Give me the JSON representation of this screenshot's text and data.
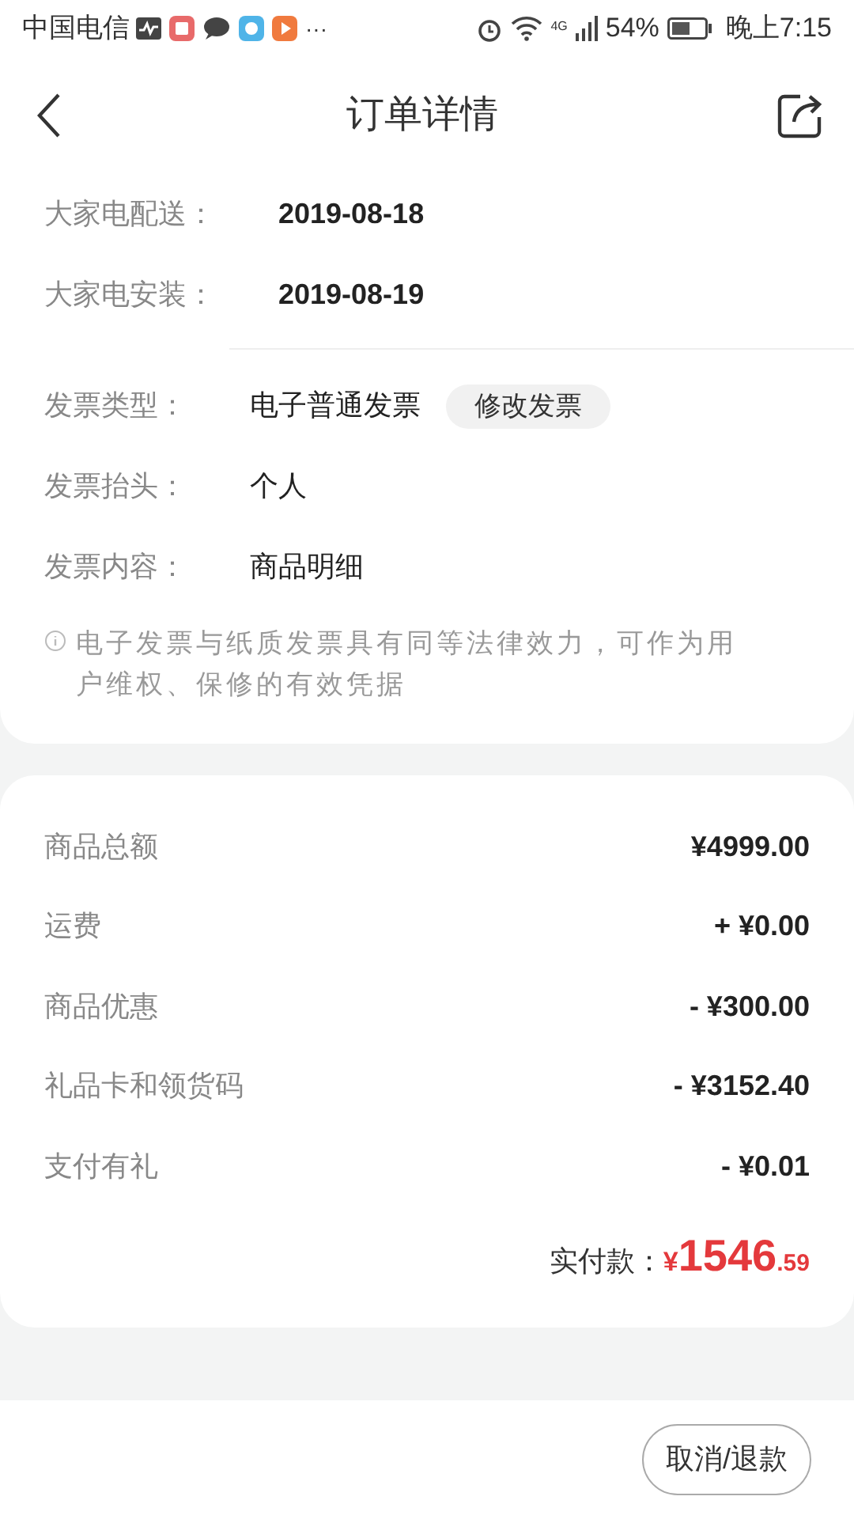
{
  "status_bar": {
    "carrier": "中国电信",
    "more": "···",
    "battery_text": "54%",
    "time": "晚上7:15",
    "network": "4G"
  },
  "header": {
    "title": "订单详情"
  },
  "delivery": [
    {
      "label": "大家电配送：",
      "value": "2019-08-18"
    },
    {
      "label": "大家电安装：",
      "value": "2019-08-19"
    }
  ],
  "invoice": {
    "rows": [
      {
        "label": "发票类型：",
        "value": "电子普通发票",
        "action": "修改发票"
      },
      {
        "label": "发票抬头：",
        "value": "个人"
      },
      {
        "label": "发票内容：",
        "value": "商品明细"
      }
    ],
    "note": "电子发票与纸质发票具有同等法律效力，可作为用户维权、保修的有效凭据"
  },
  "costs": [
    {
      "label": "商品总额",
      "value": "¥4999.00"
    },
    {
      "label": "运费",
      "value": "+ ¥0.00"
    },
    {
      "label": "商品优惠",
      "value": "- ¥300.00"
    },
    {
      "label": "礼品卡和领货码",
      "value": "- ¥3152.40"
    },
    {
      "label": "支付有礼",
      "value": "- ¥0.01"
    }
  ],
  "total": {
    "label": "实付款：",
    "currency": "¥",
    "integer": "1546",
    "decimal": ".59"
  },
  "bottom_bar": {
    "buttons": [
      "取消/退款"
    ]
  }
}
